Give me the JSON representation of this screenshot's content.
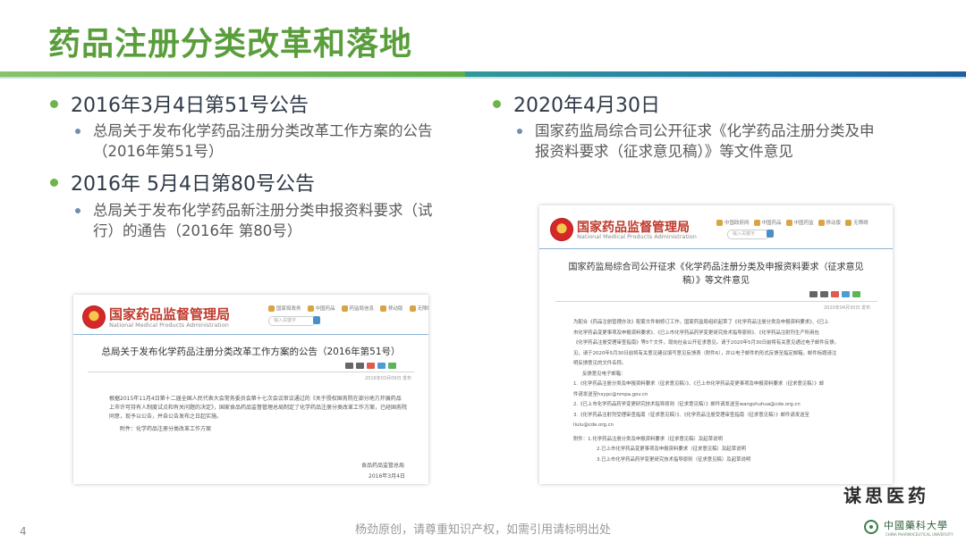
{
  "slide": {
    "title": "药品注册分类改革和落地",
    "page_number": "4",
    "footer": "杨劲原创，请尊重知识产权，如需引用请标明出处",
    "brand": "谋思医药",
    "university": "中國藥科大學",
    "university_en": "CHINA PHARMACEUTICAL UNIVERSITY",
    "accent_colors": {
      "title": "#5a9e3c",
      "bullet": "#6db44a",
      "rule_left": "#6db44a",
      "rule_right": "#2378a8"
    }
  },
  "left": {
    "bullet1": {
      "heading": "2016年3月4日第51号公告",
      "sub_line1": "总局关于发布化学药品注册分类改革工作方案的公告",
      "sub_line2": "（2016年第51号）"
    },
    "bullet2": {
      "heading": "2016年 5月4日第80号公告",
      "sub_line1": "总局关于发布化学药品新注册分类申报资料要求（试",
      "sub_line2": "行）的通告（2016年 第80号）"
    }
  },
  "right": {
    "bullet1": {
      "heading": "2020年4月30日",
      "sub_line1": "国家药监局综合司公开征求《化学药品注册分类及申",
      "sub_line2": "报资料要求（征求意见稿）》等文件意见"
    }
  },
  "doc_left": {
    "agency_cn": "国家药品监督管理局",
    "agency_en": "National Medical Products Administration",
    "search_placeholder": "输入关键字",
    "nav": [
      "国家局政务",
      "中国药品",
      "药监局信息",
      "移动版",
      "无障碍浏览"
    ],
    "title": "总局关于发布化学药品注册分类改革工作方案的公告（2016年第51号）",
    "meta": "2016年03月09日 发布",
    "body": [
      "根据2015年11月4日第十二届全国人民代表大会常务委员会第十七次会议审议通过的《关于授权国务院在部分地方开展药品",
      "上市许可持有人制度试点和有关问题的决定》，国家食品药品监督管理总局制定了化学药品注册分类改革工作方案，已经国务院",
      "同意，现予以公告，并自公告发布之日起实施。",
      "附件：化学药品注册分类改革工作方案"
    ],
    "sign": "食品药品监管总局",
    "date": "2016年3月4日"
  },
  "doc_right": {
    "agency_cn": "国家药品监督管理局",
    "agency_en": "National Medical Products Administration",
    "search_placeholder": "输入关键字",
    "nav": [
      "中国政府网",
      "中国药品",
      "中国药监",
      "移动版",
      "无障碍"
    ],
    "title_line1": "国家药监局综合司公开征求《化学药品注册分类及申报资料要求（征求意见",
    "title_line2": "稿）》等文件意见",
    "meta": "2020年04月30日 发布",
    "body": [
      "为配合《药品注册管理办法》配套文件制修订工作，国家药监局组织起草了《化学药品注册分类及申报资料要求》、《已上",
      "市化学药品变更事项及申报资料要求》、《已上市化学药品药学变更研究技术指导原则》、《化学药品注射剂生产所用包",
      "《化学药品注册受理审查指南》等5个文件，现向社会公开征求意见。请于2020年5月30日前将有关意见通过电子邮件反馈。",
      "见，请于2020年5月30日前将有关意见建议填写意见反馈表（附件6），并以电子邮件的形式反馈至指定邮箱，邮件标题请注",
      "明反馈意见的文件名称。",
      "反馈意见电子邮箱：",
      "1.《化学药品注册分类及申报资料要求（征求意见稿）》、《已上市化学药品变更事项及申报资料要求（征求意见稿）》邮",
      "件请发送至hxypc@nmpa.gov.cn",
      "2.《已上市化学药品药学变更研究技术指导原则（征求意见稿）》邮件请发送至wangshuhua@cde.org.cn",
      "3.《化学药品注射剂受理审查指南（征求意见稿）》、《化学药品注册受理审查指南（征求意见稿）》邮件请发送至",
      "liulu@cde.org.cn",
      "附件：1.化学药品注册分类及申报资料要求（征求意见稿）及起草说明",
      "2.已上市化学药品变更事项及申报资料要求（征求意见稿）及起草说明",
      "3.已上市化学药品药学变更研究技术指导原则（征求意见稿）及起草说明"
    ]
  }
}
